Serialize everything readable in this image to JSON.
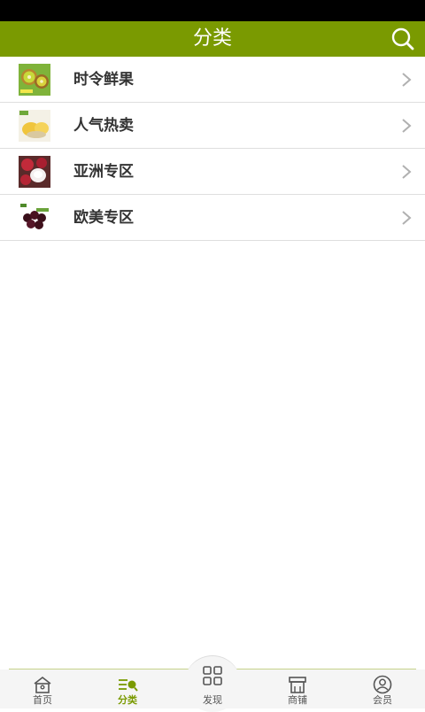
{
  "header": {
    "title": "分类",
    "search_icon": "search-icon"
  },
  "categories": [
    {
      "label": "时令鲜果",
      "thumb": "kiwi-fruit-thumb"
    },
    {
      "label": "人气热卖",
      "thumb": "durian-fruit-thumb"
    },
    {
      "label": "亚洲专区",
      "thumb": "lychee-fruit-thumb"
    },
    {
      "label": "欧美专区",
      "thumb": "cherry-fruit-thumb"
    }
  ],
  "tabbar": {
    "active": "分类",
    "tabs": [
      {
        "label": "首页",
        "icon": "home-icon"
      },
      {
        "label": "分类",
        "icon": "category-icon"
      },
      {
        "label": "发现",
        "icon": "grid-icon"
      },
      {
        "label": "商铺",
        "icon": "store-icon"
      },
      {
        "label": "会员",
        "icon": "user-icon"
      }
    ]
  },
  "colors": {
    "brand": "#7a9a01",
    "status_bar": "#000000"
  }
}
